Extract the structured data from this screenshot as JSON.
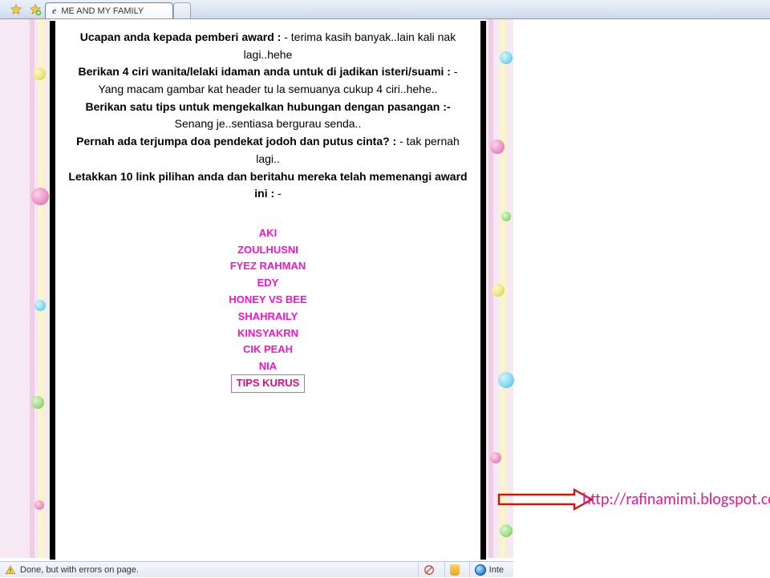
{
  "tabbar": {
    "active_tab_title": "ME AND MY FAMILY"
  },
  "content": {
    "qa": [
      {
        "q": "Ucapan anda kepada pemberi award :",
        "a": " - terima kasih banyak..lain kali nak lagi..hehe"
      },
      {
        "q": "Berikan 4 ciri wanita/lelaki idaman anda untuk di jadikan isteri/suami :",
        "a": " - Yang macam gambar kat header tu la semuanya cukup 4 ciri..hehe.."
      },
      {
        "q": "Berikan satu tips untuk mengekalkan hubungan dengan pasangan :-",
        "a": " Senang je..sentiasa bergurau senda.."
      },
      {
        "q": "Pernah ada terjumpa doa pendekat jodoh dan putus cinta? :",
        "a": " - tak pernah lagi.."
      },
      {
        "q": "Letakkan 10 link pilihan anda dan beritahu mereka telah memenangi award ini :",
        "a": " -"
      }
    ],
    "links": [
      "AKI",
      "ZOULHUSNI",
      "FYEZ RAHMAN",
      "EDY",
      "HONEY VS BEE",
      "SHAHRAILY",
      "KINSYAKRN",
      "CIK PEAH",
      "NIA",
      "TIPS KURUS"
    ]
  },
  "statusbar": {
    "message": "Done, but with errors on page.",
    "zone": "Inte"
  },
  "annotation": {
    "url": "http://rafinamimi.blogspot.com/"
  }
}
